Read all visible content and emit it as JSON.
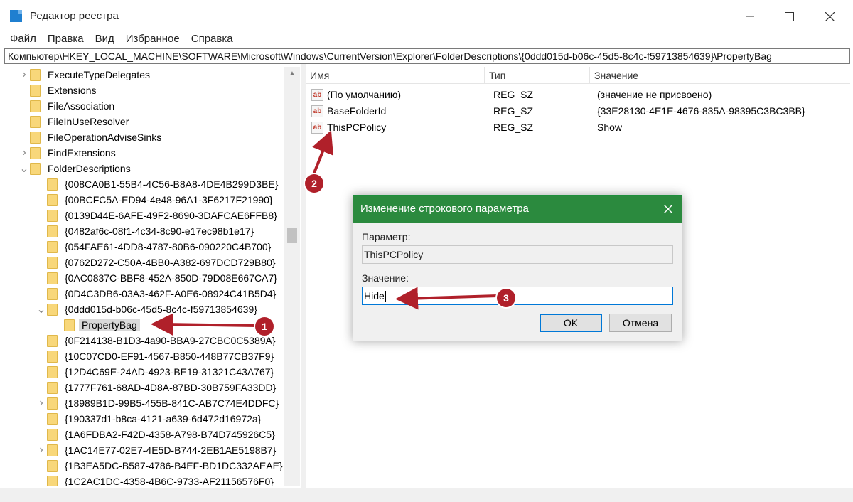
{
  "window": {
    "title": "Редактор реестра",
    "icon": "regedit-icon"
  },
  "menu": [
    "Файл",
    "Правка",
    "Вид",
    "Избранное",
    "Справка"
  ],
  "address": "Компьютер\\HKEY_LOCAL_MACHINE\\SOFTWARE\\Microsoft\\Windows\\CurrentVersion\\Explorer\\FolderDescriptions\\{0ddd015d-b06c-45d5-8c4c-f59713854639}\\PropertyBag",
  "tree": [
    {
      "label": "ExecuteTypeDelegates",
      "expander": "collapsed",
      "selected": false
    },
    {
      "label": "Extensions",
      "expander": "none",
      "selected": false
    },
    {
      "label": "FileAssociation",
      "expander": "none",
      "selected": false
    },
    {
      "label": "FileInUseResolver",
      "expander": "none",
      "selected": false
    },
    {
      "label": "FileOperationAdviseSinks",
      "expander": "none",
      "selected": false
    },
    {
      "label": "FindExtensions",
      "expander": "collapsed",
      "selected": false
    },
    {
      "label": "FolderDescriptions",
      "expander": "expanded",
      "selected": false
    },
    {
      "label": "{008CA0B1-55B4-4C56-B8A8-4DE4B299D3BE}",
      "expander": "none",
      "selected": false
    },
    {
      "label": "{00BCFC5A-ED94-4e48-96A1-3F6217F21990}",
      "expander": "none",
      "selected": false
    },
    {
      "label": "{0139D44E-6AFE-49F2-8690-3DAFCAE6FFB8}",
      "expander": "none",
      "selected": false
    },
    {
      "label": "{0482af6c-08f1-4c34-8c90-e17ec98b1e17}",
      "expander": "none",
      "selected": false
    },
    {
      "label": "{054FAE61-4DD8-4787-80B6-090220C4B700}",
      "expander": "none",
      "selected": false
    },
    {
      "label": "{0762D272-C50A-4BB0-A382-697DCD729B80}",
      "expander": "none",
      "selected": false
    },
    {
      "label": "{0AC0837C-BBF8-452A-850D-79D08E667CA7}",
      "expander": "none",
      "selected": false
    },
    {
      "label": "{0D4C3DB6-03A3-462F-A0E6-08924C41B5D4}",
      "expander": "none",
      "selected": false
    },
    {
      "label": "{0ddd015d-b06c-45d5-8c4c-f59713854639}",
      "expander": "expanded",
      "selected": false
    },
    {
      "label": "PropertyBag",
      "expander": "none",
      "selected": true
    },
    {
      "label": "{0F214138-B1D3-4a90-BBA9-27CBC0C5389A}",
      "expander": "none",
      "selected": false
    },
    {
      "label": "{10C07CD0-EF91-4567-B850-448B77CB37F9}",
      "expander": "none",
      "selected": false
    },
    {
      "label": "{12D4C69E-24AD-4923-BE19-31321C43A767}",
      "expander": "none",
      "selected": false
    },
    {
      "label": "{1777F761-68AD-4D8A-87BD-30B759FA33DD}",
      "expander": "none",
      "selected": false
    },
    {
      "label": "{18989B1D-99B5-455B-841C-AB7C74E4DDFC}",
      "expander": "collapsed",
      "selected": false
    },
    {
      "label": "{190337d1-b8ca-4121-a639-6d472d16972a}",
      "expander": "none",
      "selected": false
    },
    {
      "label": "{1A6FDBA2-F42D-4358-A798-B74D745926C5}",
      "expander": "none",
      "selected": false
    },
    {
      "label": "{1AC14E77-02E7-4E5D-B744-2EB1AE5198B7}",
      "expander": "collapsed",
      "selected": false
    },
    {
      "label": "{1B3EA5DC-B587-4786-B4EF-BD1DC332AEAE}",
      "expander": "none",
      "selected": false
    },
    {
      "label": "{1C2AC1DC-4358-4B6C-9733-AF21156576F0}",
      "expander": "none",
      "selected": false
    }
  ],
  "list": {
    "columns": [
      "Имя",
      "Тип",
      "Значение"
    ],
    "rows": [
      {
        "name": "(По умолчанию)",
        "type": "REG_SZ",
        "value": "(значение не присвоено)"
      },
      {
        "name": "BaseFolderId",
        "type": "REG_SZ",
        "value": "{33E28130-4E1E-4676-835A-98395C3BC3BB}"
      },
      {
        "name": "ThisPCPolicy",
        "type": "REG_SZ",
        "value": "Show"
      }
    ],
    "icon_text": "ab"
  },
  "dialog": {
    "title": "Изменение строкового параметра",
    "param_label": "Параметр:",
    "param_value": "ThisPCPolicy",
    "value_label": "Значение:",
    "value_text": "Hide",
    "ok_label": "OK",
    "cancel_label": "Отмена",
    "accent": "#2b8a3e"
  },
  "annotations": {
    "step1": "1",
    "step2": "2",
    "step3": "3",
    "color": "#b0202a"
  }
}
